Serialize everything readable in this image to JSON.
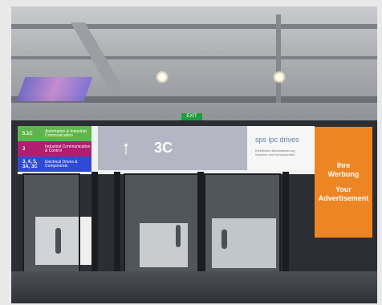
{
  "scene": {
    "description_free": true,
    "sign_rows": [
      {
        "number": "5.1C",
        "text": "Automation & Industrial Communication",
        "color": "#5fb54b"
      },
      {
        "number": "3",
        "text": "Industrial Communication & Control",
        "color": "#b11d6f"
      },
      {
        "number": "3, 4, 5, 3A, 3C",
        "text": "Electrical Drives & Components",
        "color": "#2f4bd6"
      }
    ],
    "arrow": "↑",
    "hall_label": "3C",
    "logo_text": "sps ipc drives",
    "logo_subtext": "Elektrische Automatisierung Systeme und Komponenten",
    "exit_text": "EXIT",
    "ad": {
      "line1": "Ihre",
      "line2": "Werbung",
      "line3": "Your",
      "line4": "Advertisement",
      "color": "#ee8523"
    }
  }
}
